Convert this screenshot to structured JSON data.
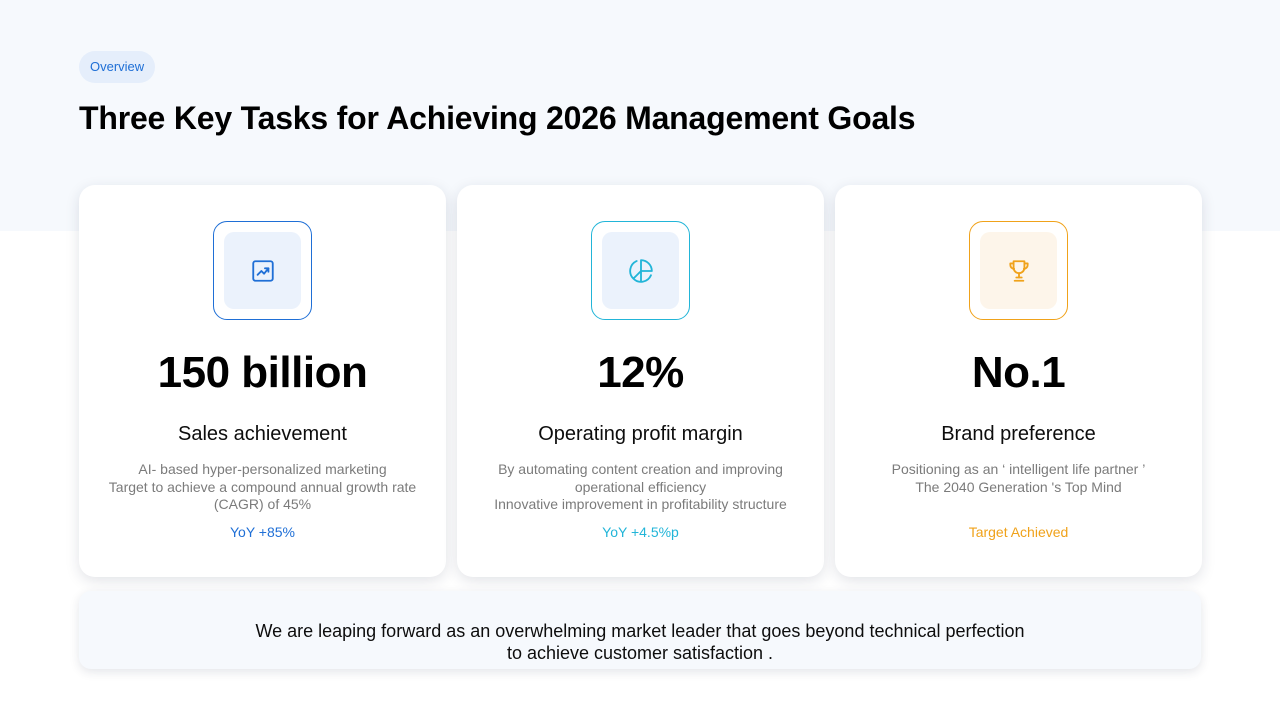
{
  "header": {
    "pill": "Overview",
    "title": "Three Key Tasks for Achieving 2026 Management Goals"
  },
  "colors": {
    "blue": "#1f6fd6",
    "cyan": "#22b5d8",
    "orange": "#f0a21a"
  },
  "cards": [
    {
      "icon": "trending-up-icon",
      "metric": "150 billion",
      "title": "Sales achievement",
      "desc_lines": [
        "AI- based hyper-personalized marketing",
        "Target to achieve a compound annual growth rate (CAGR) of 45%"
      ],
      "stat": "YoY +85%"
    },
    {
      "icon": "pie-chart-icon",
      "metric": "12%",
      "title": "Operating profit margin",
      "desc_lines": [
        "By automating content creation and improving operational efficiency",
        "Innovative improvement in profitability structure"
      ],
      "stat": "YoY +4.5%p"
    },
    {
      "icon": "trophy-icon",
      "metric": "No.1",
      "title": "Brand preference",
      "desc_lines": [
        "Positioning as an ‘ intelligent life partner ’",
        "The 2040 Generation 's Top Mind"
      ],
      "stat": "Target Achieved"
    }
  ],
  "footer": {
    "line1": "We are leaping forward as an overwhelming market leader that goes beyond technical perfection",
    "line2": "to achieve customer satisfaction ."
  }
}
